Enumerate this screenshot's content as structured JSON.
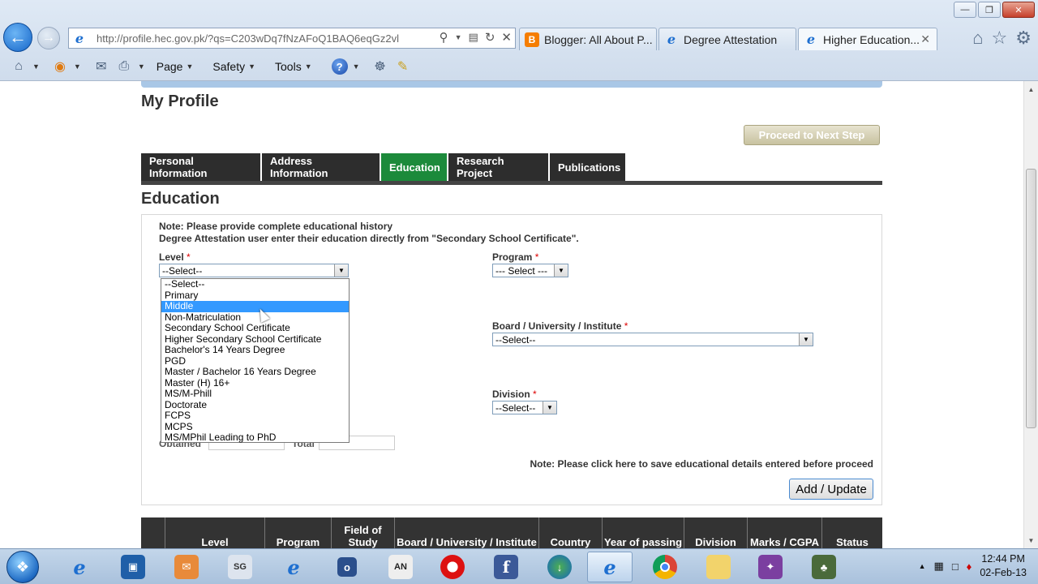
{
  "browser": {
    "url": "http://profile.hec.gov.pk/?qs=C203wDq7fNzAFoQ1BAQ6eqGz2vl",
    "tabs": [
      {
        "label": "Blogger: All About P...",
        "active": false
      },
      {
        "label": "Degree Attestation",
        "active": false
      },
      {
        "label": "Higher Education...",
        "active": true
      }
    ],
    "commands": {
      "page": "Page",
      "safety": "Safety",
      "tools": "Tools"
    }
  },
  "page": {
    "title": "My Profile",
    "proceed_button": "Proceed to Next Step",
    "tabs": [
      "Personal Information",
      "Address Information",
      "Education",
      "Research Project",
      "Publications"
    ],
    "active_tab": "Education",
    "section_title": "Education",
    "note_line1": "Note: Please provide complete educational history",
    "note_line2": "Degree Attestation user enter their education directly from \"Secondary School Certificate\".",
    "fields": {
      "level_label": "Level",
      "level_value": "--Select--",
      "program_label": "Program",
      "program_value": "--- Select ---",
      "board_label": "Board / University / Institute",
      "board_value": "--Select--",
      "division_label": "Division",
      "division_value": "--Select--",
      "obtained_label": "Obtained",
      "total_label": "Total",
      "required_mark": "*"
    },
    "level_options": [
      "--Select--",
      "Primary",
      "Middle",
      "Non-Matriculation",
      "Secondary School Certificate",
      "Higher Secondary School Certificate",
      "Bachelor's 14 Years Degree",
      "PGD",
      "Master / Bachelor 16 Years Degree",
      "Master (H) 16+",
      "MS/M-Phill",
      "Doctorate",
      "FCPS",
      "MCPS",
      "MS/MPhil Leading to PhD"
    ],
    "highlighted_option": "Middle",
    "save_note": "Note: Please click here to save educational details entered before proceed",
    "add_update_button": "Add / Update",
    "table_headers": [
      "Level",
      "Program",
      "Field of Study",
      "Board / University / Institute",
      "Country",
      "Year of passing",
      "Division",
      "Marks / CGPA",
      "Status"
    ]
  },
  "taskbar": {
    "time": "12:44 PM",
    "date": "02-Feb-13"
  }
}
